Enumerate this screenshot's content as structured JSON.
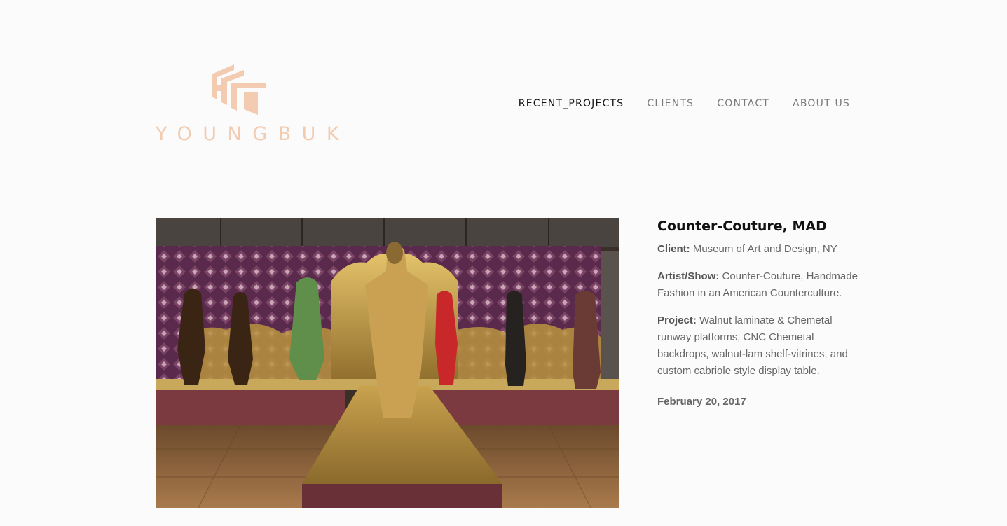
{
  "brand": {
    "name": "YOUNGBUK",
    "logo_icon": "youngbuk-logo-mark"
  },
  "nav": [
    {
      "label": "RECENT_PROJECTS",
      "active": true
    },
    {
      "label": "CLIENTS",
      "active": false
    },
    {
      "label": "CONTACT",
      "active": false
    },
    {
      "label": "ABOUT US",
      "active": false
    }
  ],
  "project": {
    "title": "Counter-Couture, MAD",
    "client_label": "Client:",
    "client_value": "Museum of Art and Design, NY",
    "artist_label": "Artist/Show:",
    "artist_value": "Counter-Couture, Handmade Fashion in an American Counterculture.",
    "project_label": "Project:",
    "project_value": "Walnut laminate & Chemetal runway platforms, CNC Chemetal backdrops, walnut-lam shelf-vitrines, and custom cabriole style display table.",
    "date": "February 20, 2017",
    "image_icon": "exhibition-photo"
  },
  "colors": {
    "brand": "#f2cbb0",
    "background": "#fbfbfb",
    "divider": "#dcdcdc"
  }
}
